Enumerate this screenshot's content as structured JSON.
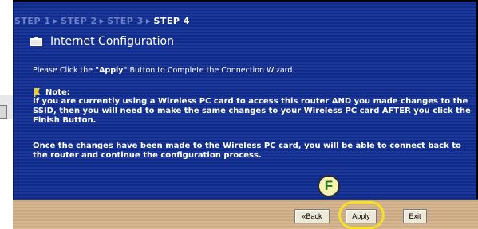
{
  "wizard": {
    "steps": [
      "STEP 1",
      "STEP 2",
      "STEP 3",
      "STEP 4"
    ],
    "active_step": "STEP 4",
    "section_title": "Internet Configuration",
    "instruction_pre": "Please Click the ",
    "instruction_bold": "\"Apply\"",
    "instruction_post": " Button to Complete the Connection Wizard.",
    "note_label": "Note:",
    "note_paragraph1": "If you are currently using a Wireless PC card to access this router AND you made changes to the SSID, then you will need to make the same changes to your Wireless PC card AFTER you click the Finish Button.",
    "note_paragraph2": "Once the changes have been made to the Wireless PC card, you will be able to connect back to the router and continue the configuration process."
  },
  "buttons": {
    "back_label": "«Back",
    "apply_label": "Apply",
    "exit_label": "Exit"
  },
  "callout": {
    "label": "F"
  },
  "colors": {
    "panel": "#112a88",
    "bottom_bar": "#c9a882",
    "highlight": "#f4e12a",
    "callout_text": "#1e7a1e"
  }
}
